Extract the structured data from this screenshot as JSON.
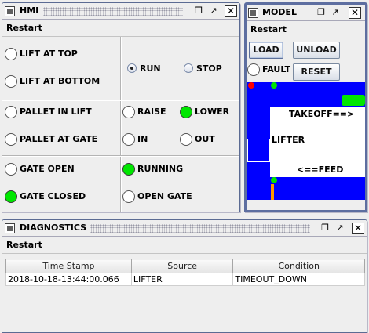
{
  "hmi": {
    "title": "HMI",
    "menu": "Restart",
    "indicators": [
      {
        "label": "LIFT AT TOP",
        "on": false
      },
      {
        "label": "LIFT AT BOTTOM",
        "on": false
      },
      {
        "label": "PALLET IN LIFT",
        "on": false
      },
      {
        "label": "PALLET AT GATE",
        "on": false
      },
      {
        "label": "GATE OPEN",
        "on": false
      },
      {
        "label": "GATE CLOSED",
        "on": true
      },
      {
        "label": "RAISE",
        "on": false
      },
      {
        "label": "LOWER",
        "on": true
      },
      {
        "label": "IN",
        "on": false
      },
      {
        "label": "OUT",
        "on": false
      },
      {
        "label": "RUNNING",
        "on": true
      },
      {
        "label": "OPEN GATE",
        "on": false
      }
    ],
    "mode": {
      "run": "RUN",
      "stop": "STOP",
      "selected": "RUN"
    }
  },
  "model": {
    "title": "MODEL",
    "menu": "Restart",
    "buttons": {
      "load": "LOAD",
      "unload": "UNLOAD",
      "reset": "RESET"
    },
    "fault": {
      "label": "FAULT",
      "on": false
    },
    "canvas": {
      "takeoff": "TAKEOFF==>",
      "lifter": "LIFTER",
      "feed": "<==FEED",
      "colors": {
        "background": "#0000ff",
        "sensor_on": "#00e600",
        "sensor_fault": "#ff0000",
        "bar": "#ff9900"
      }
    }
  },
  "diagnostics": {
    "title": "DIAGNOSTICS",
    "menu": "Restart",
    "columns": [
      "Time Stamp",
      "Source",
      "Condition"
    ],
    "rows": [
      [
        "2018-10-18-13:44:00.066",
        "LIFTER",
        "TIMEOUT_DOWN"
      ]
    ]
  }
}
